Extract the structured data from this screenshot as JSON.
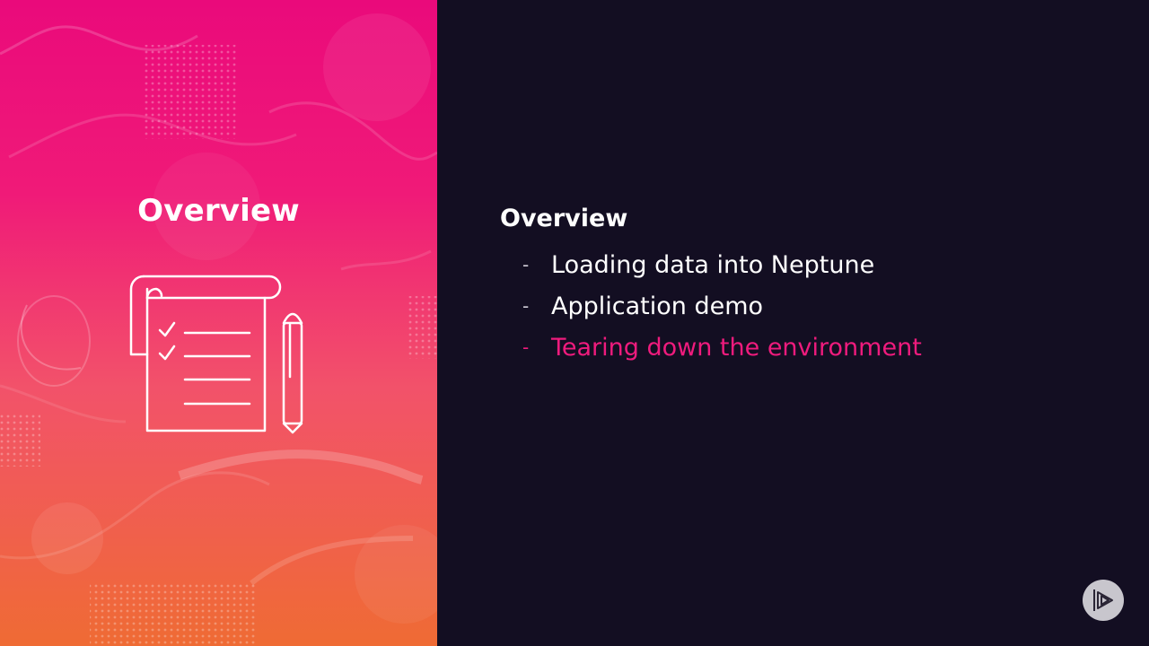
{
  "slide": {
    "left_title": "Overview",
    "illustration_icon": "checklist-notepad-pen-icon",
    "outline_title": "Overview",
    "outline_items": [
      {
        "label": "Loading data into Neptune",
        "state": "normal"
      },
      {
        "label": "Application demo",
        "state": "normal"
      },
      {
        "label": "Tearing down the environment",
        "state": "current"
      }
    ],
    "logo_icon": "play-logo-icon"
  },
  "colors": {
    "accent": "#ef1b7d",
    "panel_top": "#ea0a7b",
    "panel_bottom": "#ef6b34",
    "background": "#130e22",
    "text": "#ffffff"
  }
}
